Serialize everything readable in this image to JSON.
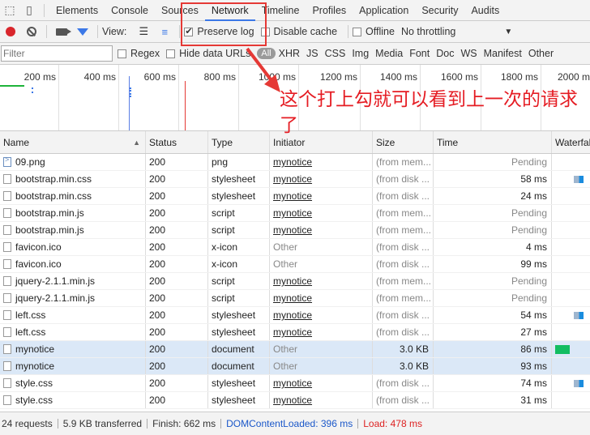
{
  "tabs": [
    "Elements",
    "Console",
    "Sources",
    "Network",
    "Timeline",
    "Profiles",
    "Application",
    "Security",
    "Audits"
  ],
  "active_tab": "Network",
  "toolbar": {
    "view_label": "View:",
    "preserve_log_label": "Preserve log",
    "preserve_log_checked": true,
    "disable_cache_label": "Disable cache",
    "offline_label": "Offline",
    "throttling_value": "No throttling"
  },
  "filter": {
    "placeholder": "Filter",
    "regex_label": "Regex",
    "hide_data_urls_label": "Hide data URLs",
    "types": [
      "All",
      "XHR",
      "JS",
      "CSS",
      "Img",
      "Media",
      "Font",
      "Doc",
      "WS",
      "Manifest",
      "Other"
    ]
  },
  "timeline_ticks": [
    "200 ms",
    "400 ms",
    "600 ms",
    "800 ms",
    "1000 ms",
    "1200 ms",
    "1400 ms",
    "1600 ms",
    "1800 ms",
    "2000 ms"
  ],
  "annotation": {
    "text": "这个打上勾就可以看到上一次的请求了",
    "color": "#e51c23"
  },
  "columns": {
    "name": "Name",
    "status": "Status",
    "type": "Type",
    "initiator": "Initiator",
    "size": "Size",
    "time": "Time",
    "waterfall": "Waterfall"
  },
  "rows": [
    {
      "name": "09.png",
      "status": "200",
      "type": "png",
      "initiator": "mynotice",
      "size": "(from mem...",
      "time": "Pending",
      "icon": "image-file-icon",
      "selected": false,
      "bar": ""
    },
    {
      "name": "bootstrap.min.css",
      "status": "200",
      "type": "stylesheet",
      "initiator": "mynotice",
      "size": "(from disk ...",
      "time": "58 ms",
      "icon": "file-icon",
      "selected": false,
      "bar": "blue"
    },
    {
      "name": "bootstrap.min.css",
      "status": "200",
      "type": "stylesheet",
      "initiator": "mynotice",
      "size": "(from disk ...",
      "time": "24 ms",
      "icon": "file-icon",
      "selected": false,
      "bar": ""
    },
    {
      "name": "bootstrap.min.js",
      "status": "200",
      "type": "script",
      "initiator": "mynotice",
      "size": "(from mem...",
      "time": "Pending",
      "icon": "file-icon",
      "selected": false,
      "bar": ""
    },
    {
      "name": "bootstrap.min.js",
      "status": "200",
      "type": "script",
      "initiator": "mynotice",
      "size": "(from mem...",
      "time": "Pending",
      "icon": "file-icon",
      "selected": false,
      "bar": ""
    },
    {
      "name": "favicon.ico",
      "status": "200",
      "type": "x-icon",
      "initiator": "Other",
      "size": "(from disk ...",
      "time": "4 ms",
      "icon": "file-icon",
      "selected": false,
      "bar": ""
    },
    {
      "name": "favicon.ico",
      "status": "200",
      "type": "x-icon",
      "initiator": "Other",
      "size": "(from disk ...",
      "time": "99 ms",
      "icon": "file-icon",
      "selected": false,
      "bar": ""
    },
    {
      "name": "jquery-2.1.1.min.js",
      "status": "200",
      "type": "script",
      "initiator": "mynotice",
      "size": "(from mem...",
      "time": "Pending",
      "icon": "file-icon",
      "selected": false,
      "bar": ""
    },
    {
      "name": "jquery-2.1.1.min.js",
      "status": "200",
      "type": "script",
      "initiator": "mynotice",
      "size": "(from mem...",
      "time": "Pending",
      "icon": "file-icon",
      "selected": false,
      "bar": ""
    },
    {
      "name": "left.css",
      "status": "200",
      "type": "stylesheet",
      "initiator": "mynotice",
      "size": "(from disk ...",
      "time": "54 ms",
      "icon": "file-icon",
      "selected": false,
      "bar": "blue"
    },
    {
      "name": "left.css",
      "status": "200",
      "type": "stylesheet",
      "initiator": "mynotice",
      "size": "(from disk ...",
      "time": "27 ms",
      "icon": "file-icon",
      "selected": false,
      "bar": ""
    },
    {
      "name": "mynotice",
      "status": "200",
      "type": "document",
      "initiator": "Other",
      "size": "3.0 KB",
      "time": "86 ms",
      "icon": "file-icon",
      "selected": true,
      "bar": "green"
    },
    {
      "name": "mynotice",
      "status": "200",
      "type": "document",
      "initiator": "Other",
      "size": "3.0 KB",
      "time": "93 ms",
      "icon": "file-icon",
      "selected": true,
      "bar": ""
    },
    {
      "name": "style.css",
      "status": "200",
      "type": "stylesheet",
      "initiator": "mynotice",
      "size": "(from disk ...",
      "time": "74 ms",
      "icon": "file-icon",
      "selected": false,
      "bar": "blue"
    },
    {
      "name": "style.css",
      "status": "200",
      "type": "stylesheet",
      "initiator": "mynotice",
      "size": "(from disk ...",
      "time": "31 ms",
      "icon": "file-icon",
      "selected": false,
      "bar": ""
    }
  ],
  "status": {
    "requests": "24 requests",
    "transferred": "5.9 KB transferred",
    "finish": "Finish: 662 ms",
    "dom_content_loaded": "DOMContentLoaded: 396 ms",
    "load": "Load: 478 ms",
    "dcl_color": "#1a57c9",
    "load_color": "#d22"
  }
}
